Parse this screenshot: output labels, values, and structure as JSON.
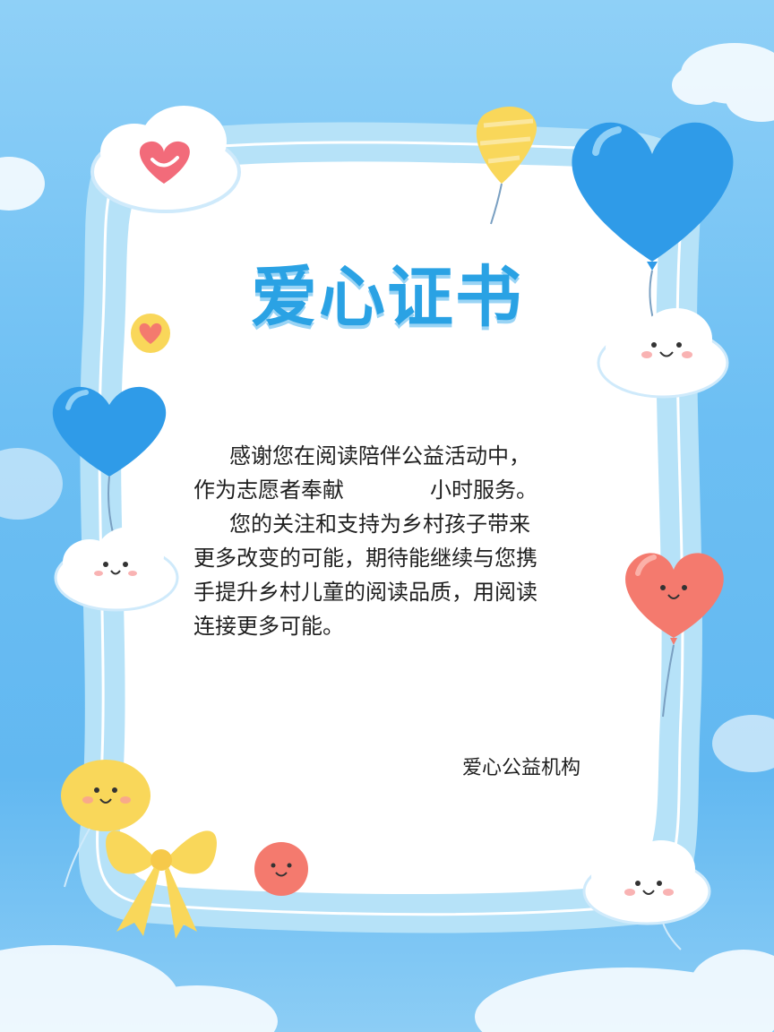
{
  "certificate": {
    "title": "爱心证书",
    "body": {
      "line1": "感谢您在阅读陪伴公益活动中，",
      "line2_before_blank": "作为志愿者奉献",
      "line2_after_blank": "小时服务。",
      "line3": "您的关注和支持为乡村孩子带来",
      "line4": "更多改变的可能，期待能继续与您携",
      "line5": "手提升乡村儿童的阅读品质，用阅读",
      "line6": "连接更多可能。"
    },
    "signature": "爱心公益机构"
  },
  "colors": {
    "sky": "#6dbff3",
    "frame": "#a7dcf7",
    "title_blue": "#2aa2e4",
    "balloon_blue": "#2f9be8",
    "balloon_pink": "#f47a6e",
    "balloon_yellow": "#f9d75a",
    "text": "#1f1f1f"
  },
  "decorations": [
    "cloud-heart-icon",
    "yellow-balloon-icon",
    "blue-heart-balloon-icon",
    "smiling-cloud-icon",
    "small-heart-icon",
    "pink-heart-balloon-icon",
    "yellow-smiley-balloon-icon",
    "yellow-bow-icon",
    "pink-smiley-icon"
  ]
}
